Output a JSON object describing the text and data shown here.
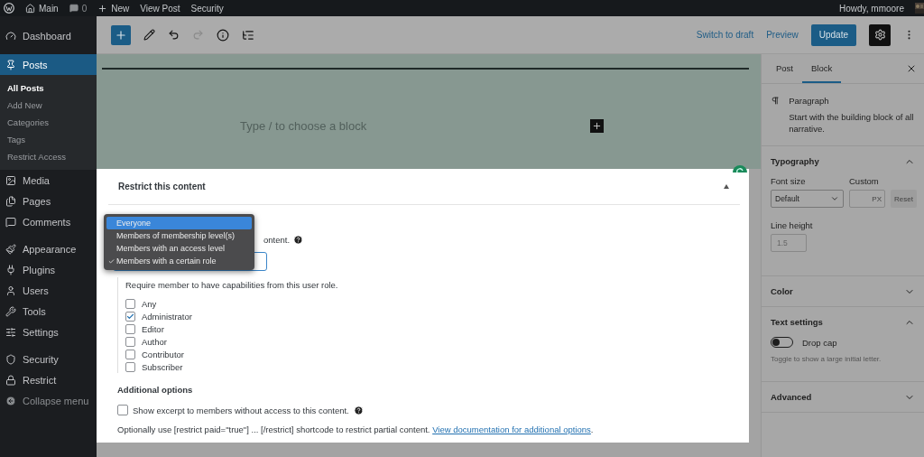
{
  "admin_bar": {
    "site": "Main",
    "comments": "0",
    "new": "New",
    "links": [
      "View Post",
      "Security"
    ],
    "greeting": "Howdy, mmoore"
  },
  "sidebar": {
    "groups": [
      {
        "items": [
          {
            "label": "Dashboard",
            "selected": false
          }
        ]
      },
      {
        "items": [
          {
            "label": "Posts",
            "selected": true,
            "children": [
              {
                "label": "All Posts",
                "selected": true
              },
              {
                "label": "Add New",
                "selected": false
              },
              {
                "label": "Categories",
                "selected": false
              },
              {
                "label": "Tags",
                "selected": false
              },
              {
                "label": "Restrict Access",
                "selected": false
              }
            ]
          },
          {
            "label": "Media",
            "selected": false
          },
          {
            "label": "Pages",
            "selected": false
          },
          {
            "label": "Comments",
            "selected": false
          }
        ]
      },
      {
        "items": [
          {
            "label": "Appearance",
            "selected": false
          },
          {
            "label": "Plugins",
            "selected": false
          },
          {
            "label": "Users",
            "selected": false
          },
          {
            "label": "Tools",
            "selected": false
          },
          {
            "label": "Settings",
            "selected": false
          }
        ]
      },
      {
        "items": [
          {
            "label": "Security",
            "selected": false
          },
          {
            "label": "Restrict",
            "selected": false
          }
        ]
      }
    ],
    "collapse": "Collapse menu"
  },
  "toolbar": {
    "redo_disabled": true,
    "switch_to_draft": "Switch to draft",
    "preview": "Preview",
    "update": "Update"
  },
  "editor": {
    "placeholder": "Type / to choose a block"
  },
  "restrict_panel": {
    "title": "Restrict this content",
    "expanded": true,
    "description_visible": "ontent.",
    "options": [
      {
        "label": "Everyone",
        "highlighted": true,
        "selected": false
      },
      {
        "label": "Members of membership level(s)",
        "highlighted": false,
        "selected": false
      },
      {
        "label": "Members with an access level",
        "highlighted": false,
        "selected": false
      },
      {
        "label": "Members with a certain role",
        "highlighted": false,
        "selected": true
      }
    ],
    "role_hint": "Require member to have capabilities from this user role.",
    "roles": [
      {
        "label": "Any",
        "checked": false
      },
      {
        "label": "Administrator",
        "checked": true
      },
      {
        "label": "Editor",
        "checked": false
      },
      {
        "label": "Author",
        "checked": false
      },
      {
        "label": "Contributor",
        "checked": false
      },
      {
        "label": "Subscriber",
        "checked": false
      }
    ],
    "additional_heading": "Additional options",
    "excerpt": {
      "label": "Show excerpt to members without access to this content.",
      "checked": false
    },
    "note": "Optionally use [restrict paid=\"true\"] ... [/restrict] shortcode to restrict partial content. ",
    "note_link": "View documentation for additional options",
    "note_end": "."
  },
  "settings": {
    "tabs": [
      {
        "label": "Post",
        "selected": false
      },
      {
        "label": "Block",
        "selected": true
      }
    ],
    "block": {
      "name": "Paragraph",
      "description": "Start with the building block of all narrative."
    },
    "sections": [
      {
        "kind": "typography",
        "title": "Typography",
        "expanded": true,
        "font_size_label": "Font size",
        "font_size_value": "Default",
        "custom_label": "Custom",
        "custom_unit": "PX",
        "reset": "Reset",
        "reset_disabled": true,
        "line_height_label": "Line height",
        "line_height_value": "1.5"
      },
      {
        "title": "Color",
        "expanded": false
      },
      {
        "kind": "text_settings",
        "title": "Text settings",
        "expanded": true,
        "toggle_label": "Drop cap",
        "on": false,
        "help": "Toggle to show a large initial letter."
      },
      {
        "title": "Advanced",
        "expanded": false
      }
    ]
  }
}
